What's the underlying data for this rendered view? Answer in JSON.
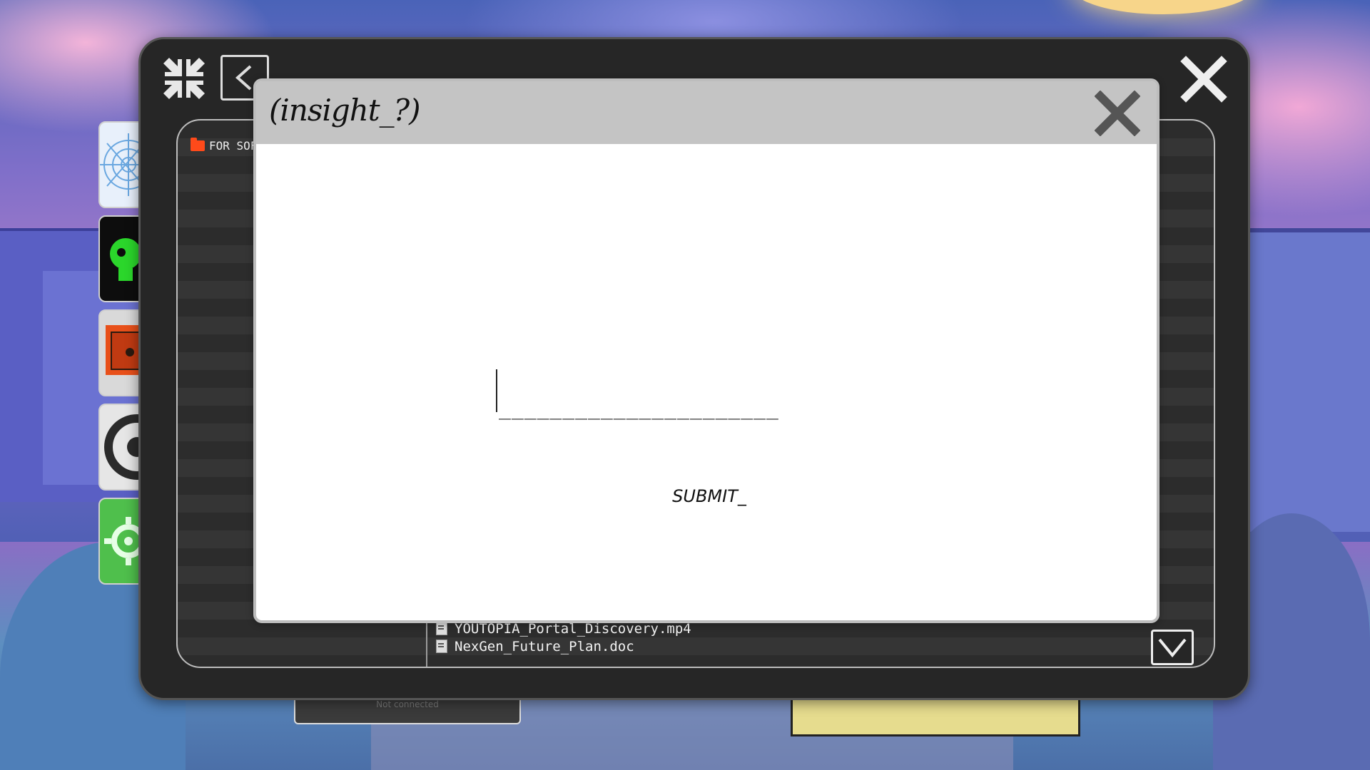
{
  "window": {
    "breadcrumb": "FOR SOF",
    "files": [
      {
        "name": "YOUTOPIA_Portal_Discovery.mp4"
      },
      {
        "name": "NexGen_Future_Plan.doc"
      }
    ]
  },
  "dialog": {
    "title": "(insight_?)",
    "answer_placeholder": "______________________",
    "submit_label": "SUBMIT_"
  },
  "taskbar": {
    "network_status": "Not connected"
  },
  "colors": {
    "window_bg": "#262626",
    "dialog_header": "#c4c4c4",
    "folder_accent": "#ff4a1a",
    "app_green": "#4fbf4c"
  }
}
